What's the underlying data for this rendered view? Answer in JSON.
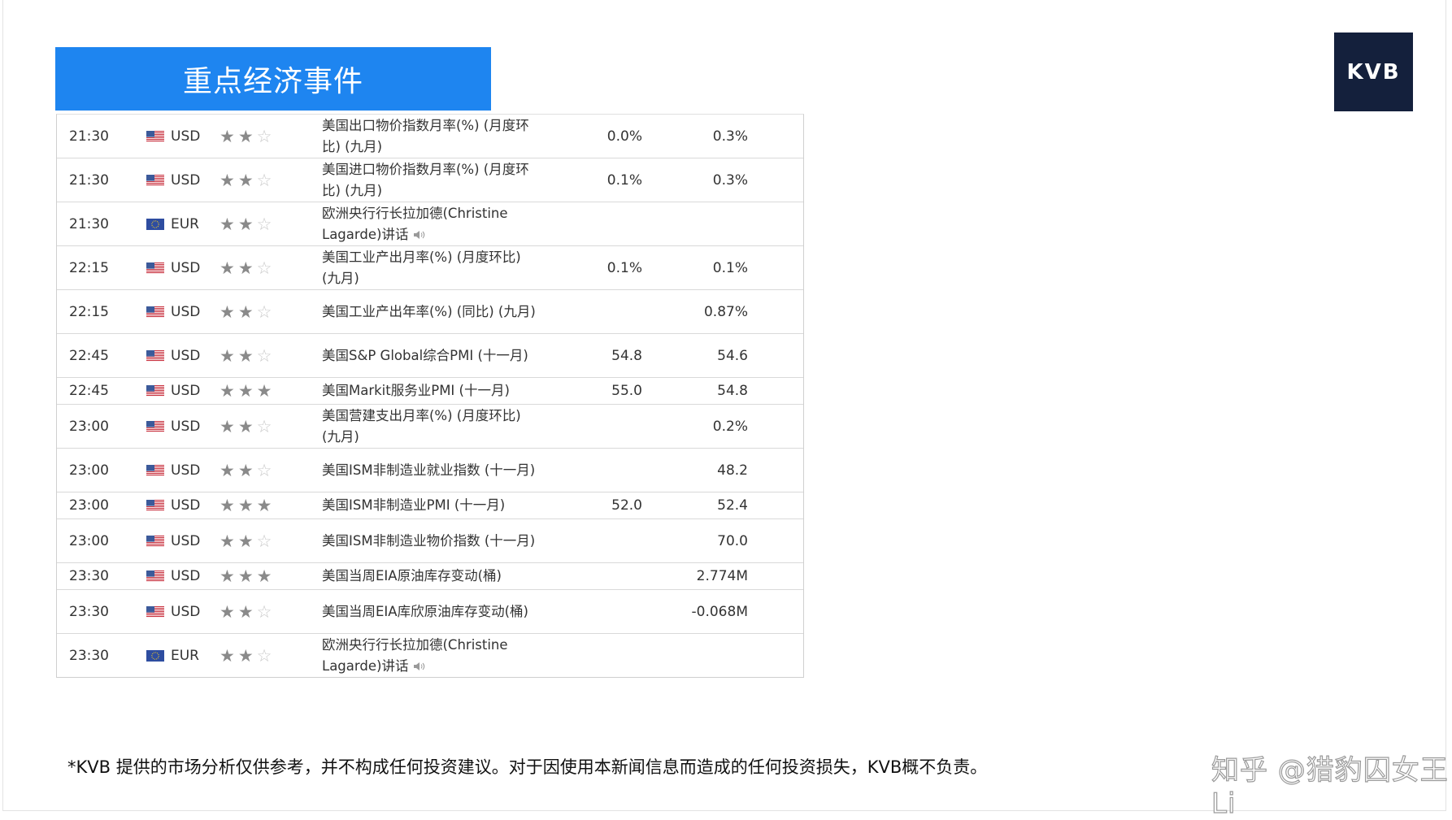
{
  "header": {
    "title": "重点经济事件",
    "logo": "KVB"
  },
  "events": [
    {
      "time": "21:30",
      "flag": "us-flag-icon",
      "currency": "USD",
      "stars": 2,
      "event": "美国出口物价指数月率(%) (月度环比) (九月)",
      "forecast": "0.0%",
      "previous": "0.3%",
      "speaker": false
    },
    {
      "time": "21:30",
      "flag": "us-flag-icon",
      "currency": "USD",
      "stars": 2,
      "event": "美国进口物价指数月率(%) (月度环比) (九月)",
      "forecast": "0.1%",
      "previous": "0.3%",
      "speaker": false
    },
    {
      "time": "21:30",
      "flag": "eu-flag-icon",
      "currency": "EUR",
      "stars": 2,
      "event": "欧洲央行行长拉加德(Christine Lagarde)讲话",
      "forecast": "",
      "previous": "",
      "speaker": true
    },
    {
      "time": "22:15",
      "flag": "us-flag-icon",
      "currency": "USD",
      "stars": 2,
      "event": "美国工业产出月率(%) (月度环比) (九月)",
      "forecast": "0.1%",
      "previous": "0.1%",
      "speaker": false
    },
    {
      "time": "22:15",
      "flag": "us-flag-icon",
      "currency": "USD",
      "stars": 2,
      "event": "美国工业产出年率(%) (同比) (九月)",
      "forecast": "",
      "previous": "0.87%",
      "speaker": false
    },
    {
      "time": "22:45",
      "flag": "us-flag-icon",
      "currency": "USD",
      "stars": 2,
      "event": "美国S&P Global综合PMI (十一月)",
      "forecast": "54.8",
      "previous": "54.6",
      "speaker": false
    },
    {
      "time": "22:45",
      "flag": "us-flag-icon",
      "currency": "USD",
      "stars": 3,
      "event": "美国Markit服务业PMI (十一月)",
      "forecast": "55.0",
      "previous": "54.8",
      "speaker": false
    },
    {
      "time": "23:00",
      "flag": "us-flag-icon",
      "currency": "USD",
      "stars": 2,
      "event": "美国营建支出月率(%) (月度环比) (九月)",
      "forecast": "",
      "previous": "0.2%",
      "speaker": false
    },
    {
      "time": "23:00",
      "flag": "us-flag-icon",
      "currency": "USD",
      "stars": 2,
      "event": "美国ISM非制造业就业指数 (十一月)",
      "forecast": "",
      "previous": "48.2",
      "speaker": false
    },
    {
      "time": "23:00",
      "flag": "us-flag-icon",
      "currency": "USD",
      "stars": 3,
      "event": "美国ISM非制造业PMI (十一月)",
      "forecast": "52.0",
      "previous": "52.4",
      "speaker": false
    },
    {
      "time": "23:00",
      "flag": "us-flag-icon",
      "currency": "USD",
      "stars": 2,
      "event": "美国ISM非制造业物价指数 (十一月)",
      "forecast": "",
      "previous": "70.0",
      "speaker": false
    },
    {
      "time": "23:30",
      "flag": "us-flag-icon",
      "currency": "USD",
      "stars": 3,
      "event": "美国当周EIA原油库存变动(桶)",
      "forecast": "",
      "previous": "2.774M",
      "speaker": false
    },
    {
      "time": "23:30",
      "flag": "us-flag-icon",
      "currency": "USD",
      "stars": 2,
      "event": "美国当周EIA库欣原油库存变动(桶)",
      "forecast": "",
      "previous": "-0.068M",
      "speaker": false
    },
    {
      "time": "23:30",
      "flag": "eu-flag-icon",
      "currency": "EUR",
      "stars": 2,
      "event": "欧洲央行行长拉加德(Christine Lagarde)讲话",
      "forecast": "",
      "previous": "",
      "speaker": true
    }
  ],
  "disclaimer": "*KVB 提供的市场分析仅供参考，并不构成任何投资建议。对于因使用本新闻信息而造成的任何投资损失，KVB概不负责。",
  "watermark": "知乎 @猎豹囚女王Li"
}
